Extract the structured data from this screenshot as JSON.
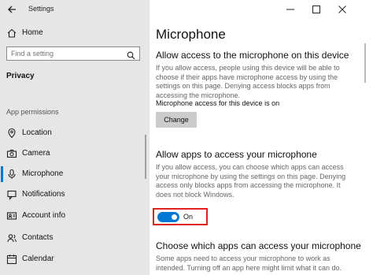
{
  "window": {
    "title": "Settings",
    "controls": [
      "minimize",
      "maximize",
      "close"
    ]
  },
  "sidebar": {
    "home_label": "Home",
    "search": {
      "placeholder": "Find a setting"
    },
    "category": "Privacy",
    "section_header": "App permissions",
    "items": [
      {
        "label": "Location",
        "icon": "location-icon",
        "selected": false
      },
      {
        "label": "Camera",
        "icon": "camera-icon",
        "selected": false
      },
      {
        "label": "Microphone",
        "icon": "microphone-icon",
        "selected": true
      },
      {
        "label": "Notifications",
        "icon": "notifications-icon",
        "selected": false
      },
      {
        "label": "Account info",
        "icon": "account-info-icon",
        "selected": false
      },
      {
        "label": "Contacts",
        "icon": "contacts-icon",
        "selected": false
      },
      {
        "label": "Calendar",
        "icon": "calendar-icon",
        "selected": false
      }
    ]
  },
  "main": {
    "title": "Microphone",
    "device_section": {
      "heading": "Allow access to the microphone on this device",
      "description": "If you allow access, people using this device will be able to choose if their apps have microphone access by using the settings on this page. Denying access blocks apps from accessing the microphone.",
      "status": "Microphone access for this device is on",
      "button_label": "Change"
    },
    "apps_section": {
      "heading": "Allow apps to access your microphone",
      "description": "If you allow access, you can choose which apps can access your microphone by using the settings on this page. Denying access only blocks apps from accessing the microphone. It does not block Windows.",
      "toggle": {
        "state": true,
        "label": "On"
      }
    },
    "choose_section": {
      "heading": "Choose which apps can access your microphone",
      "description": "Some apps need to access your microphone to work as intended. Turning off an app here might limit what it can do."
    }
  },
  "colors": {
    "accent": "#0078d4",
    "highlight_border": "#e0211d",
    "sidebar_bg": "#e6e6e6"
  }
}
